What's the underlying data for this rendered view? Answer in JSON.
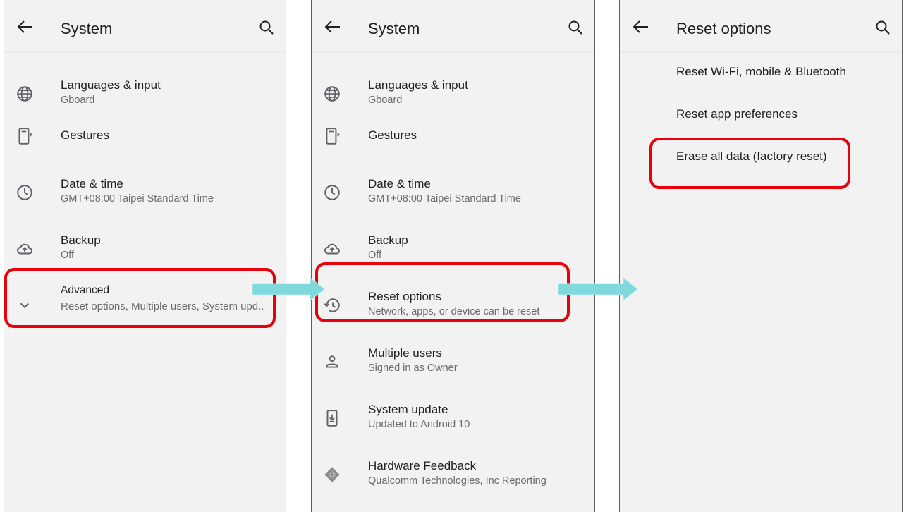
{
  "screens": [
    {
      "title": "System",
      "items": [
        {
          "label": "Languages & input",
          "sub": "Gboard",
          "icon": "globe-icon"
        },
        {
          "label": "Gestures",
          "sub": "",
          "icon": "gestures-phone-icon"
        },
        {
          "label": "Date & time",
          "sub": "GMT+08:00 Taipei Standard Time",
          "icon": "clock-icon"
        },
        {
          "label": "Backup",
          "sub": "Off",
          "icon": "cloud-upload-icon"
        },
        {
          "label": "Advanced",
          "sub": "Reset options, Multiple users, System upd..",
          "icon": "chevron-down-icon"
        }
      ]
    },
    {
      "title": "System",
      "items": [
        {
          "label": "Languages & input",
          "sub": "Gboard",
          "icon": "globe-icon"
        },
        {
          "label": "Gestures",
          "sub": "",
          "icon": "gestures-phone-icon"
        },
        {
          "label": "Date & time",
          "sub": "GMT+08:00 Taipei Standard Time",
          "icon": "clock-icon"
        },
        {
          "label": "Backup",
          "sub": "Off",
          "icon": "cloud-upload-icon"
        },
        {
          "label": "Reset options",
          "sub": "Network, apps, or device can be reset",
          "icon": "history-icon"
        },
        {
          "label": "Multiple users",
          "sub": "Signed in as Owner",
          "icon": "person-icon"
        },
        {
          "label": "System update",
          "sub": "Updated to Android 10",
          "icon": "system-update-icon"
        },
        {
          "label": "Hardware Feedback",
          "sub": "Qualcomm Technologies, Inc Reporting",
          "icon": "hardware-chip-icon"
        }
      ]
    },
    {
      "title": "Reset options",
      "items": [
        {
          "label": "Reset Wi-Fi, mobile & Bluetooth"
        },
        {
          "label": "Reset app preferences"
        },
        {
          "label": "Erase all data (factory reset)"
        }
      ]
    }
  ],
  "colors": {
    "highlight": "#e8000a",
    "arrow": "#7fd8dc",
    "background": "#f2f2f2"
  }
}
